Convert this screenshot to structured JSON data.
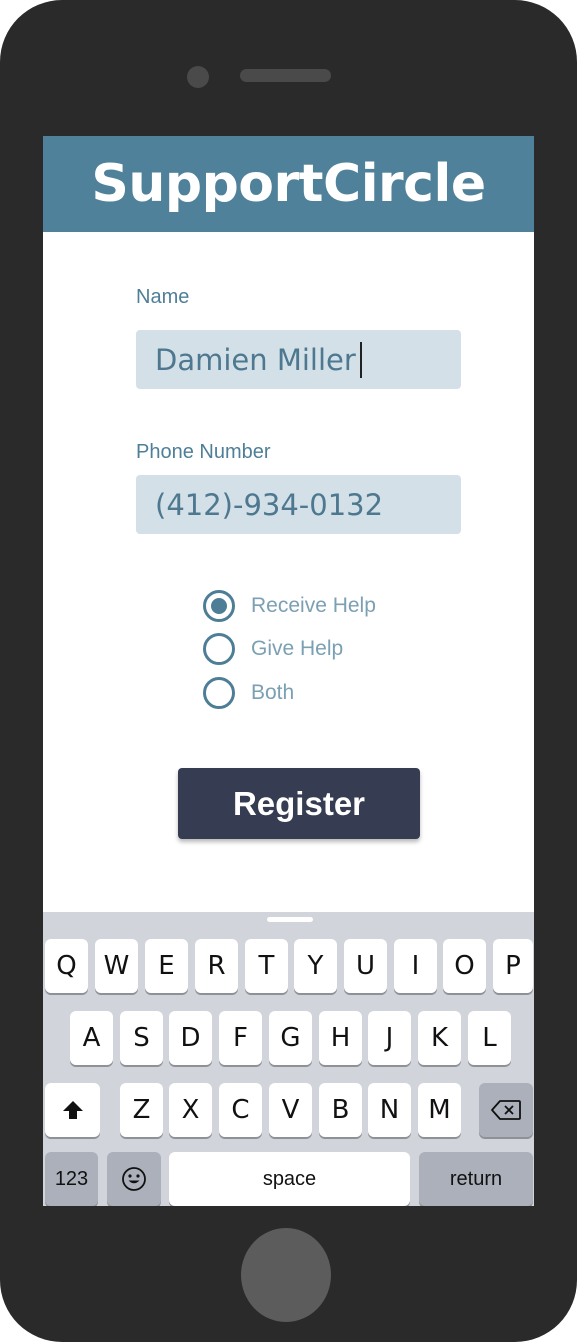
{
  "app": {
    "title": "SupportCircle"
  },
  "form": {
    "name_label": "Name",
    "name_value": "Damien Miller",
    "phone_label": "Phone Number",
    "phone_value": "(412)-934-0132",
    "options": [
      {
        "label": "Receive Help",
        "checked": true
      },
      {
        "label": "Give Help",
        "checked": false
      },
      {
        "label": "Both",
        "checked": false
      }
    ],
    "register_label": "Register"
  },
  "keyboard": {
    "row1": [
      "Q",
      "W",
      "E",
      "R",
      "T",
      "Y",
      "U",
      "I",
      "O",
      "P"
    ],
    "row2": [
      "A",
      "S",
      "D",
      "F",
      "G",
      "H",
      "J",
      "K",
      "L"
    ],
    "row3": [
      "Z",
      "X",
      "C",
      "V",
      "B",
      "N",
      "M"
    ],
    "numbers_label": "123",
    "space_label": "space",
    "return_label": "return",
    "shift_icon": "shift-icon",
    "backspace_icon": "backspace-icon",
    "emoji_icon": "emoji-icon"
  },
  "colors": {
    "header": "#50819a",
    "field_bg": "#d4e0e7",
    "accent": "#4d7e96",
    "button": "#363c51",
    "bezel": "#2a2a2a",
    "keyboard_bg": "#d1d4da"
  }
}
